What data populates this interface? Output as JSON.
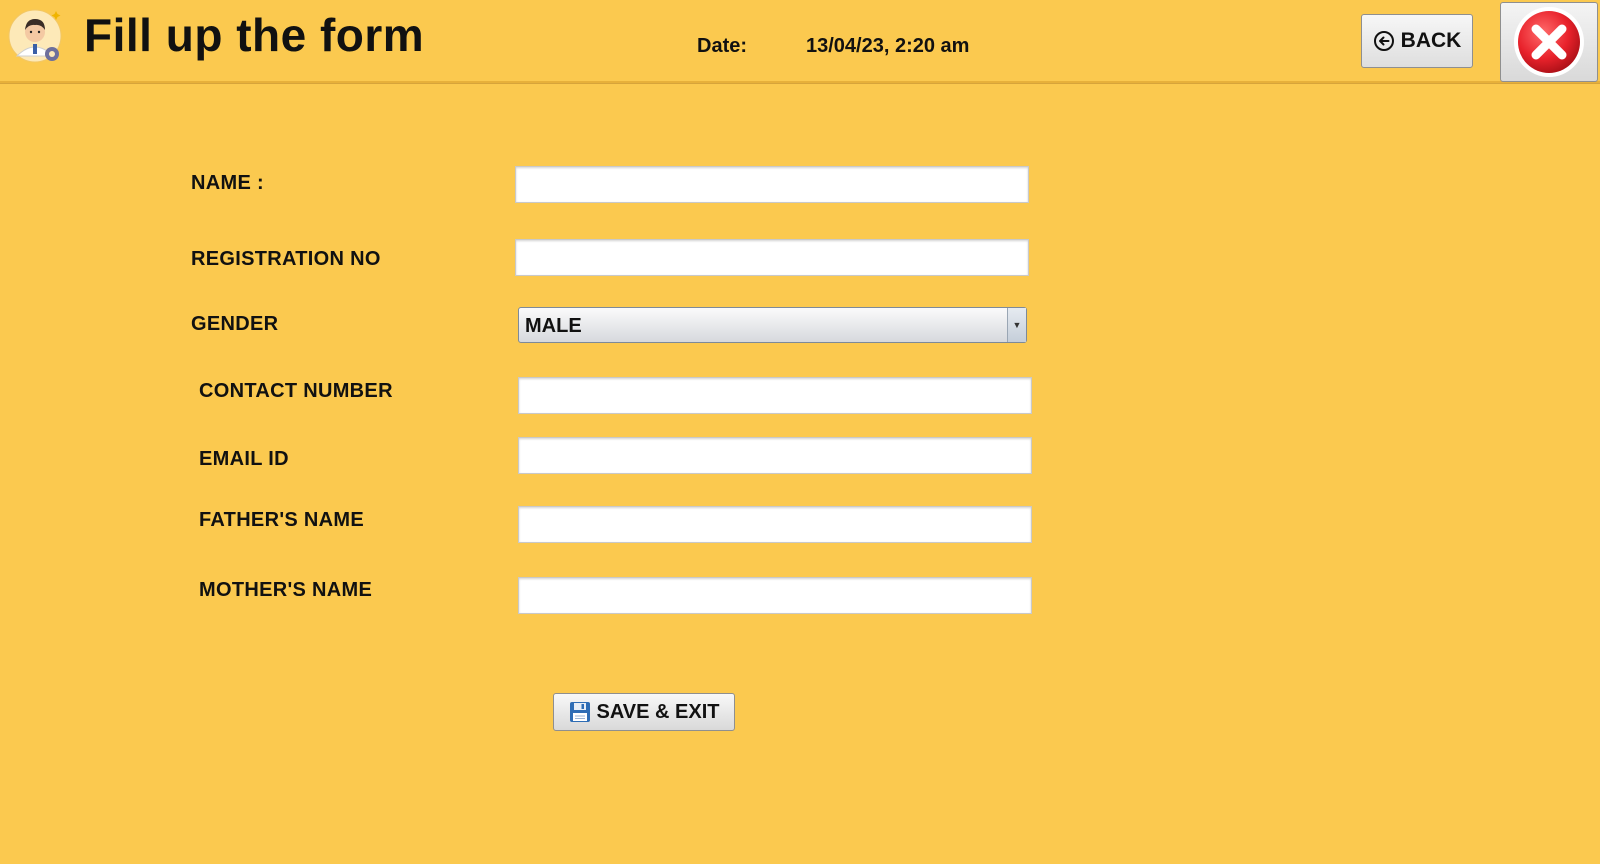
{
  "header": {
    "title": "Fill up the form",
    "date_label": "Date:",
    "date_value": "13/04/23, 2:20 am",
    "back_label": "BACK",
    "close_icon": "close-icon",
    "avatar_icon": "user-settings-icon"
  },
  "form": {
    "fields": [
      {
        "label": "NAME :",
        "value": "",
        "placeholder": ""
      },
      {
        "label": "REGISTRATION NO",
        "value": "",
        "placeholder": ""
      },
      {
        "label": "GENDER",
        "selected": "MALE"
      },
      {
        "label": "CONTACT NUMBER",
        "value": "",
        "placeholder": ""
      },
      {
        "label": "EMAIL ID",
        "value": "",
        "placeholder": ""
      },
      {
        "label": "FATHER'S NAME",
        "value": "",
        "placeholder": ""
      },
      {
        "label": "MOTHER'S NAME",
        "value": "",
        "placeholder": ""
      }
    ],
    "save_label": "SAVE & EXIT",
    "save_icon": "floppy-disk-icon"
  },
  "colors": {
    "background": "#fbc94f",
    "close_red": "#e8222b"
  }
}
